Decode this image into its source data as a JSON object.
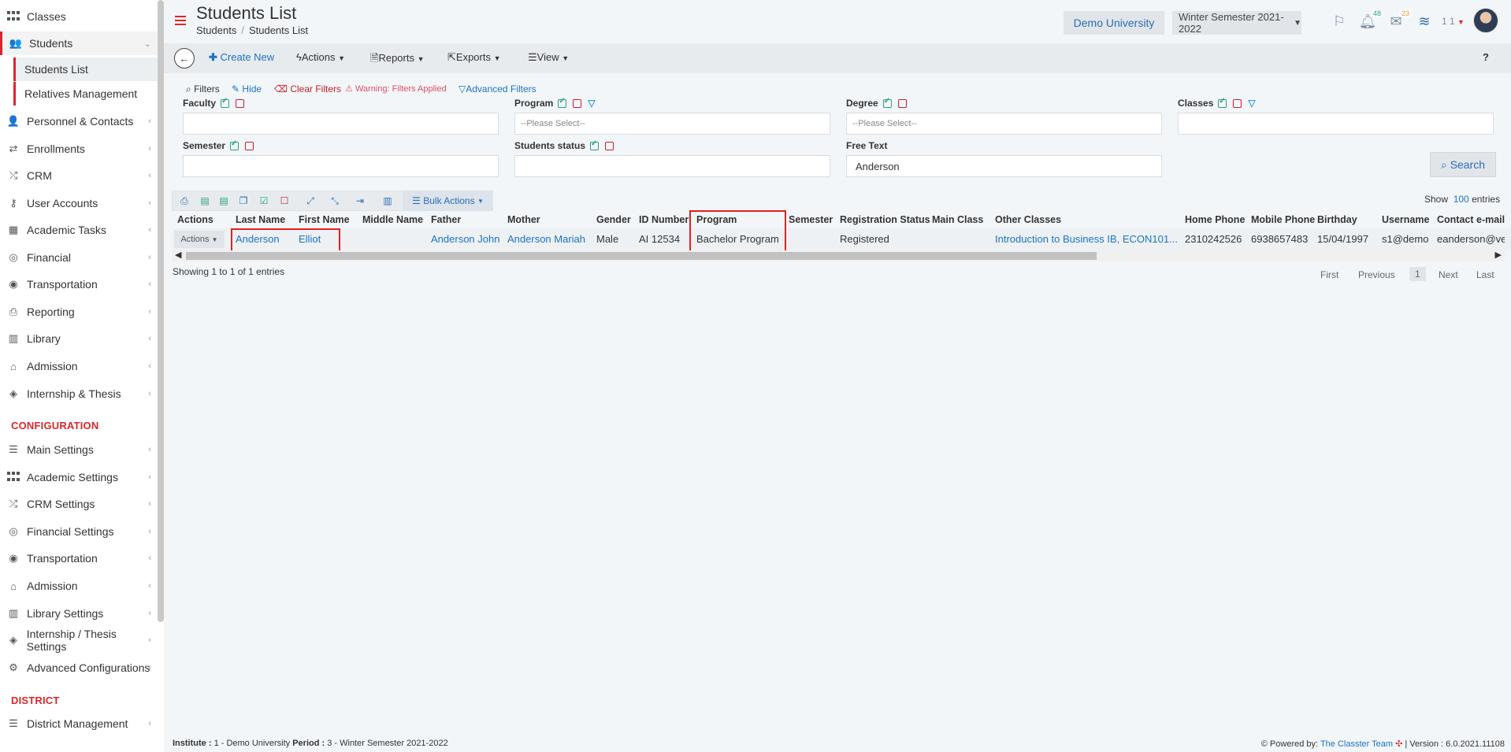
{
  "sidebar": {
    "items": [
      {
        "label": "Classes"
      },
      {
        "label": "Students"
      },
      {
        "label": "Personnel & Contacts"
      },
      {
        "label": "Enrollments"
      },
      {
        "label": "CRM"
      },
      {
        "label": "User Accounts"
      },
      {
        "label": "Academic Tasks"
      },
      {
        "label": "Financial"
      },
      {
        "label": "Transportation"
      },
      {
        "label": "Reporting"
      },
      {
        "label": "Library"
      },
      {
        "label": "Admission"
      },
      {
        "label": "Internship & Thesis"
      }
    ],
    "subitems": [
      {
        "label": "Students List"
      },
      {
        "label": "Relatives Management"
      }
    ],
    "config_heading": "CONFIGURATION",
    "config_items": [
      {
        "label": "Main Settings"
      },
      {
        "label": "Academic Settings"
      },
      {
        "label": "CRM Settings"
      },
      {
        "label": "Financial Settings"
      },
      {
        "label": "Transportation"
      },
      {
        "label": "Admission"
      },
      {
        "label": "Library Settings"
      },
      {
        "label": "Internship / Thesis Settings"
      },
      {
        "label": "Advanced Configurations"
      }
    ],
    "district_heading": "DISTRICT",
    "district_items": [
      {
        "label": "District Management"
      }
    ],
    "accent_color": "#d9262e"
  },
  "header": {
    "title": "Students List",
    "breadcrumb": [
      "Students",
      "Students List"
    ],
    "university": "Demo University",
    "semester": "Winter Semester 2021-2022",
    "notifications_count": "48",
    "messages_count": "23",
    "user_count": "1 1"
  },
  "toolbar": {
    "create_new": "Create New",
    "actions": "Actions",
    "reports": "Reports",
    "exports": "Exports",
    "view": "View",
    "help": "?"
  },
  "filters": {
    "label": "Filters",
    "hide": "Hide",
    "clear": "Clear Filters",
    "warning": "Warning: Filters Applied",
    "advanced": "Advanced Filters",
    "faculty": {
      "label": "Faculty",
      "value": ""
    },
    "program": {
      "label": "Program",
      "placeholder": "--Please Select--"
    },
    "degree": {
      "label": "Degree",
      "placeholder": "--Please Select--"
    },
    "classes": {
      "label": "Classes",
      "value": ""
    },
    "semester": {
      "label": "Semester",
      "value": ""
    },
    "students_status": {
      "label": "Students status",
      "value": ""
    },
    "free_text": {
      "label": "Free Text",
      "value": "Anderson"
    },
    "search_button": "Search"
  },
  "table_tools": {
    "bulk_actions": "Bulk Actions",
    "show_label": "Show",
    "show_count": "100",
    "entries_label": "entries"
  },
  "table": {
    "columns": [
      "Actions",
      "Last Name",
      "First Name",
      "Middle Name",
      "Father",
      "Mother",
      "Gender",
      "ID Number",
      "Program",
      "Semester",
      "Registration Status",
      "Main Class",
      "Other Classes",
      "Home Phone",
      "Mobile Phone",
      "Birthday",
      "Username",
      "Contact e-mail"
    ],
    "rows": [
      {
        "actions": "Actions",
        "last_name": "Anderson",
        "first_name": "Elliot",
        "middle_name": "",
        "father": "Anderson John",
        "mother": "Anderson Mariah",
        "gender": "Male",
        "id_number": "AI 12534",
        "program": "Bachelor Program",
        "semester": "",
        "registration_status": "Registered",
        "main_class": "",
        "other_classes": "Introduction to Business IB, ECON101...",
        "home_phone": "2310242526",
        "mobile_phone": "6938657483",
        "birthday": "15/04/1997",
        "username": "s1@demo",
        "contact_email": "eanderson@ve"
      }
    ],
    "showing": "Showing 1 to 1 of 1 entries"
  },
  "pagination": {
    "first": "First",
    "previous": "Previous",
    "current": "1",
    "next": "Next",
    "last": "Last"
  },
  "footer": {
    "institute_label": "Institute :",
    "institute_value": "1 - Demo University",
    "period_label": "Period :",
    "period_value": "3 - Winter Semester 2021-2022",
    "powered_by": "Powered by:",
    "team": "The Classter Team",
    "version": "| Version : 6.0.2021.11108"
  }
}
